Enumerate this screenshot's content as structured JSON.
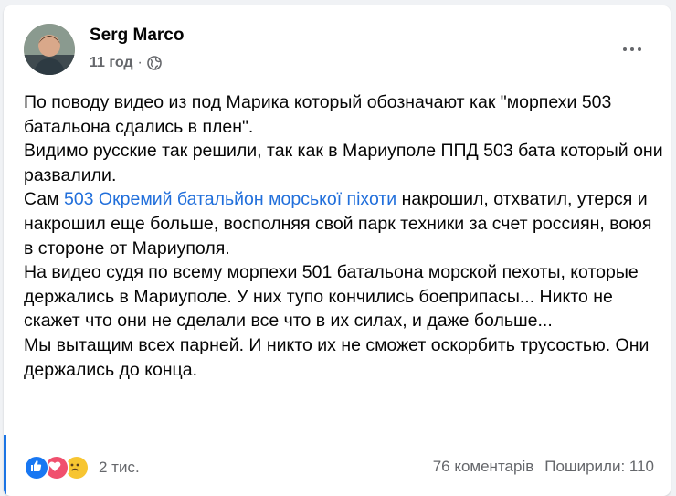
{
  "post": {
    "author": "Serg Marco",
    "time": "11 год",
    "separator": "·",
    "paragraphs": [
      {
        "text": "По поводу видео из под Марика который обозначают как \"морпехи 503 батальона сдались в плен\"."
      },
      {
        "text": "Видимо русские так решили, так как в Мариуполе ППД 503 бата который они развалили."
      },
      {
        "before": "Сам ",
        "link": "503 Окремий батальйон морської піхоти",
        "after": " накрошил, отхватил, утерся и накрошил еще больше, восполняя свой парк техники за счет россиян, воюя в стороне от Мариуполя."
      },
      {
        "text": "На видео судя по всему морпехи 501 батальона морской пехоты, которые держались в Мариуполе. У них тупо кончились боеприпасы... Никто не скажет что они не сделали все что в их силах, и даже больше..."
      },
      {
        "text": "Мы вытащим всех парней. И никто их не сможет оскорбить трусостью. Они держались до конца."
      }
    ]
  },
  "reactions": {
    "icons": [
      "like-icon",
      "love-icon",
      "sad-icon"
    ],
    "count": "2 тис."
  },
  "stats": {
    "comments": "76 коментарів",
    "shares": "Поширили: 110"
  },
  "colors": {
    "link": "#216fdb",
    "accent": "#1b74e4",
    "secondary_text": "#65676b"
  }
}
